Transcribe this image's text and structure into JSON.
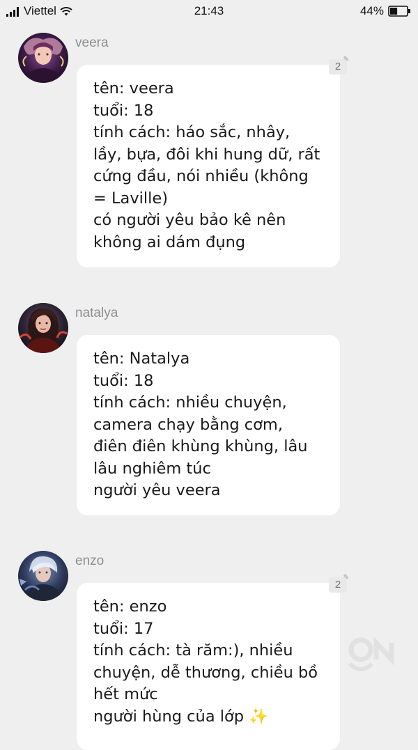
{
  "status_bar": {
    "carrier": "Viettel",
    "time": "21:43",
    "battery_percent": "44%",
    "battery_level": 0.44,
    "icons": [
      "signal-icon",
      "wifi-icon",
      "battery-icon"
    ]
  },
  "messages": [
    {
      "sender": "veera",
      "comment_count": "2",
      "lines": [
        "tên: veera",
        "tuổi: 18",
        "tính cách: háo sắc, nhây,",
        "lầy, bựa, đôi khi hung dữ, rất",
        "cứng đầu, nói nhiều (không",
        "= Laville)",
        "có người yêu bảo kê nên",
        "không ai dám đụng"
      ]
    },
    {
      "sender": "natalya",
      "comment_count": "",
      "lines": [
        "tên: Natalya",
        "tuổi: 18",
        "tính cách: nhiều chuyện,",
        "camera chạy bằng cơm,",
        "điên điên khùng khùng, lâu",
        "lâu nghiêm túc",
        "người yêu veera"
      ]
    },
    {
      "sender": "enzo",
      "comment_count": "2",
      "lines": [
        "tên: enzo",
        "tuổi: 17",
        "tính cách: tà răm:), nhiều",
        "chuyện, dễ thương, chiều bồ",
        "hết mức",
        "người hùng của lớp ✨"
      ]
    }
  ],
  "colors": {
    "background": "#efefef",
    "bubble": "#ffffff",
    "sender_name": "#8e8e8e",
    "text": "#1a1a1a"
  }
}
